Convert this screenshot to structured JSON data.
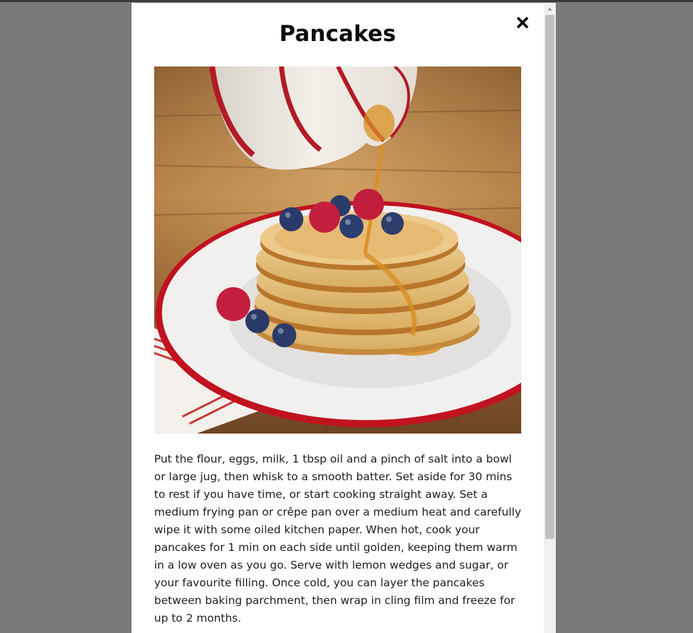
{
  "modal": {
    "title": "Pancakes",
    "close_icon": "close-icon",
    "image_alt": "Stack of pancakes with berries and syrup being poured",
    "description": "Put the flour, eggs, milk, 1 tbsp oil and a pinch of salt into a bowl or large jug, then whisk to a smooth batter. Set aside for 30 mins to rest if you have time, or start cooking straight away. Set a medium frying pan or crêpe pan over a medium heat and carefully wipe it with some oiled kitchen paper. When hot, cook your pancakes for 1 min on each side until golden, keeping them warm in a low oven as you go. Serve with lemon wedges and sugar, or your favourite filling. Once cold, you can layer the pancakes between baking parchment, then wrap in cling film and freeze for up to 2 months."
  },
  "colors": {
    "backdrop": "#7a7a7a",
    "modal_bg": "#ffffff",
    "plate_rim": "#c1121f",
    "scroll_thumb": "#c1c1c1"
  }
}
